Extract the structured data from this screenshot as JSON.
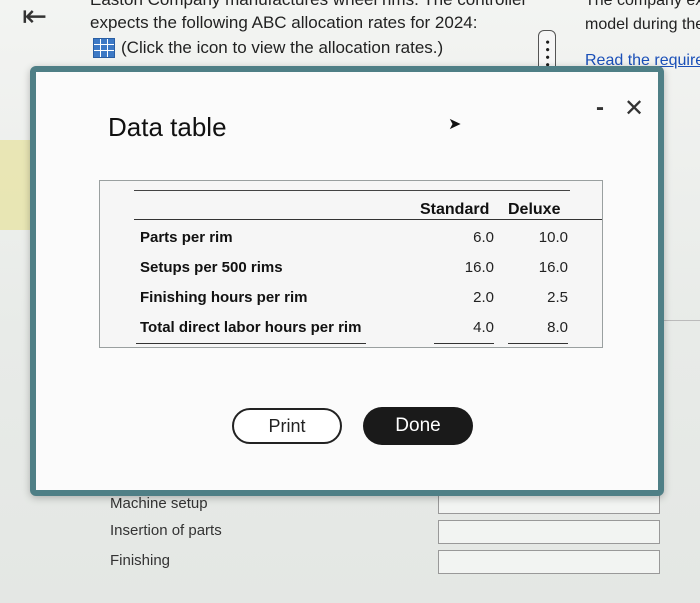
{
  "background": {
    "back_icon": "back-arrow-icon",
    "top_cut_text": "Easton Company manufactures wheel rims. The controller",
    "top_line2": "expects the following ABC allocation rates for 2024:",
    "click_text": "(Click the icon to view the allocation rates.)",
    "right_cut_text": "The company ex",
    "right_line2": "model during the",
    "read_link": "Read the require",
    "bottom_labels": [
      "Machine setup",
      "Insertion of parts",
      "Finishing"
    ]
  },
  "modal": {
    "title": "Data table",
    "minimize": "-",
    "close": "✕",
    "columns": [
      "Standard",
      "Deluxe"
    ],
    "rows": [
      {
        "label": "Parts per rim",
        "standard": "6.0",
        "deluxe": "10.0"
      },
      {
        "label": "Setups per 500 rims",
        "standard": "16.0",
        "deluxe": "16.0"
      },
      {
        "label": "Finishing hours per rim",
        "standard": "2.0",
        "deluxe": "2.5"
      },
      {
        "label": "Total direct labor hours per rim",
        "standard": "4.0",
        "deluxe": "8.0"
      }
    ],
    "print_label": "Print",
    "done_label": "Done"
  },
  "colors": {
    "modal_border": "#4f7f86",
    "done_bg": "#1a1a1a",
    "link": "#1a4fb8"
  }
}
